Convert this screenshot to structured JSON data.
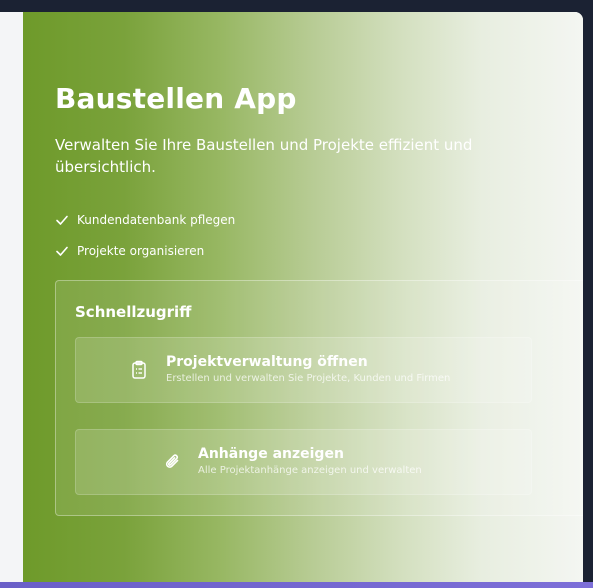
{
  "app": {
    "title": "Baustellen App",
    "subtitle": "Verwalten Sie Ihre Baustellen und Projekte effizient und übersichtlich."
  },
  "features": [
    {
      "label": "Kundendatenbank pflegen",
      "icon": "check-icon"
    },
    {
      "label": "Projekte organisieren",
      "icon": "check-icon"
    }
  ],
  "quick_access": {
    "title": "Schnellzugriff",
    "actions": [
      {
        "icon": "clipboard-list-icon",
        "label": "Projektverwaltung öffnen",
        "description": "Erstellen und verwalten Sie Projekte, Kunden und Firmen"
      },
      {
        "icon": "paperclip-icon",
        "label": "Anhänge anzeigen",
        "description": "Alle Projektanhänge anzeigen und verwalten"
      }
    ]
  },
  "colors": {
    "hero_start": "#6e9a2a",
    "hero_end": "#f4f6f2",
    "frame_background": "#1b2233",
    "bottom_strip": "#6a5fc8"
  }
}
